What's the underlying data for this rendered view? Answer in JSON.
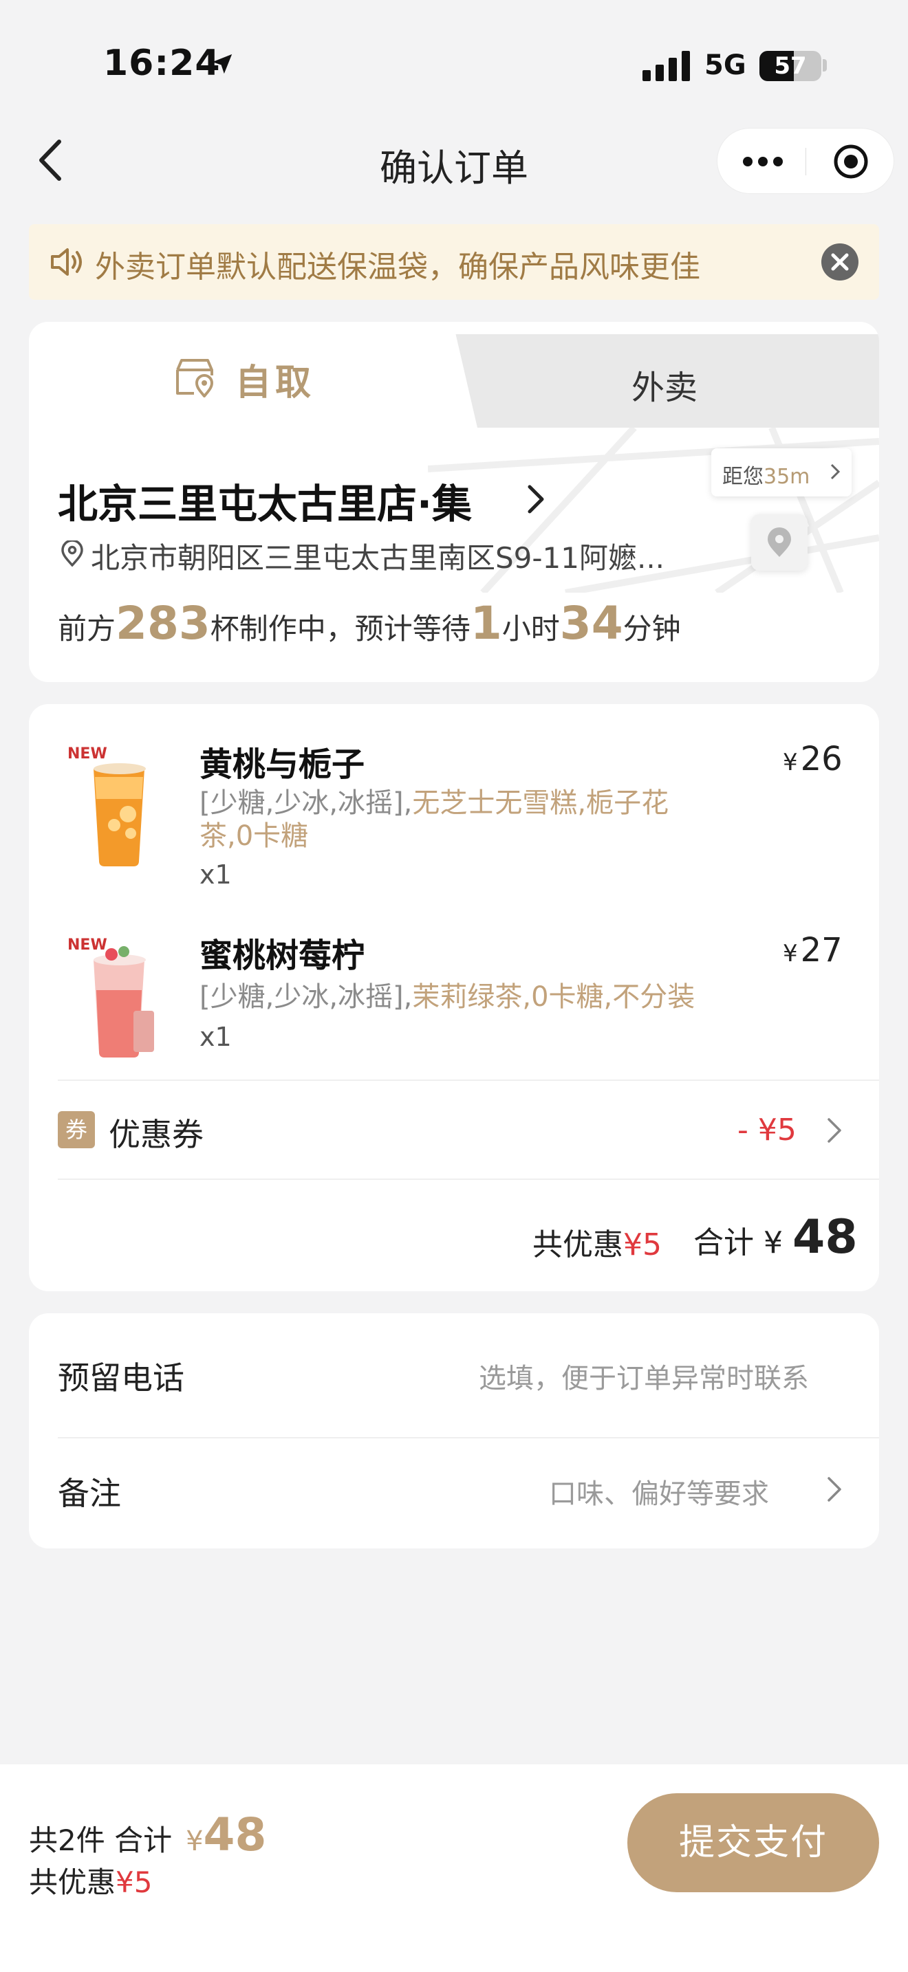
{
  "status_bar": {
    "time": "16:24",
    "network": "5G",
    "battery": "57"
  },
  "nav": {
    "title": "确认订单"
  },
  "notice": {
    "text": "外卖订单默认配送保温袋，确保产品风味更佳"
  },
  "store": {
    "tabs": {
      "pickup": "自取",
      "delivery": "外卖"
    },
    "name": "北京三里屯太古里店·集",
    "address": "北京市朝阳区三里屯太古里南区S9-11阿嬷...",
    "distance_label": "距您",
    "distance_value": "35m",
    "queue": {
      "prefix": "前方",
      "cups": "283",
      "mid": "杯制作中，预计等待",
      "hours": "1",
      "hour_unit": "小时",
      "minutes": "34",
      "minute_unit": "分钟"
    }
  },
  "order": {
    "items": [
      {
        "badge": "NEW",
        "name": "黄桃与栀子",
        "spec_base": "[少糖,少冰,冰摇],",
        "spec_extra": "无芝士无雪糕,栀子花茶,0卡糖",
        "qty": "x1",
        "currency": "¥",
        "price": "26"
      },
      {
        "badge": "NEW",
        "name": "蜜桃树莓柠",
        "spec_base": "[少糖,少冰,冰摇],",
        "spec_extra": "茉莉绿茶,0卡糖,不分装",
        "qty": "x1",
        "currency": "¥",
        "price": "27"
      }
    ],
    "coupon": {
      "badge": "券",
      "label": "优惠券",
      "value": "- ¥5"
    },
    "summary": {
      "discount_label": "共优惠",
      "discount_value": "¥5",
      "total_label": "合计",
      "currency": "¥",
      "total_value": "48"
    }
  },
  "contact": {
    "phone_label": "预留电话",
    "phone_placeholder": "选填，便于订单异常时联系",
    "remark_label": "备注",
    "remark_placeholder": "口味、偏好等要求"
  },
  "bottom_bar": {
    "count_label": "共2件  合计",
    "currency": "¥",
    "total": "48",
    "discount_label": "共优惠",
    "discount_value": "¥5",
    "pay_label": "提交支付"
  },
  "colors": {
    "accent": "#c2a27b",
    "price_red": "#e0393e",
    "notice_bg": "#fbf4e4"
  }
}
